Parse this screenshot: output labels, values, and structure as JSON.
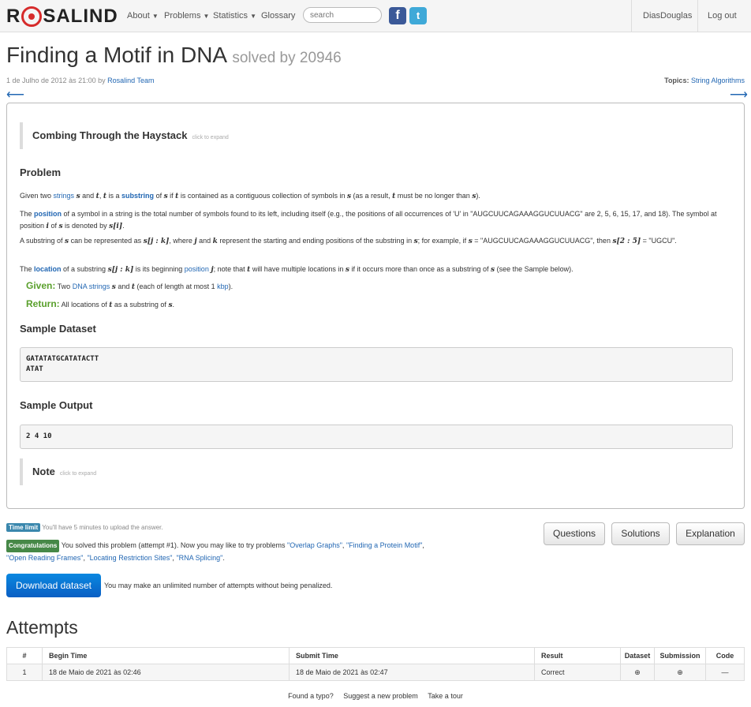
{
  "nav": {
    "brand_left": "R",
    "brand_right": "SALIND",
    "about": "About",
    "problems": "Problems",
    "statistics": "Statistics",
    "glossary": "Glossary",
    "search_placeholder": "search",
    "user": "DiasDouglas",
    "logout": "Log out"
  },
  "page": {
    "title": "Finding a Motif in DNA",
    "solved": "solved by 20946",
    "date": "1 de Julho de 2012 às 21:00 by",
    "author": "Rosalind Team",
    "topics_label": "Topics:",
    "topics": "String Algorithms"
  },
  "panel": {
    "combing_title": "Combing Through the Haystack",
    "combing_hint": "click to expand",
    "problem_heading": "Problem",
    "p1": {
      "a": "Given two ",
      "link1": "strings",
      "b": " and ",
      "c": ", ",
      "d": " is a ",
      "link2": "substring",
      "e": " of ",
      "f": " if ",
      "g": " is contained as a contiguous collection of symbols in ",
      "h": " (as a result, ",
      "i": " must be no longer than ",
      "j": ")."
    },
    "p2": {
      "a": "The ",
      "link": "position",
      "b": " of a symbol in a string is the total number of symbols found to its left, including itself (e.g., the positions of all occurrences of 'U' in \"AUGCUUCAGAAAGGUCUUACG\" are 2, 5, 6, 15, 17, and 18). The symbol at position ",
      "c": " of ",
      "d": " is denoted by ",
      "e": "."
    },
    "p3": {
      "a": "A substring of ",
      "b": " can be represented as ",
      "c": ", where ",
      "d": " and ",
      "e": " represent the starting and ending positions of the substring in ",
      "f": "; for example, if ",
      "g": " = \"AUGCUUCAGAAAGGUCUUACG\", then ",
      "h": " = \"UGCU\"."
    },
    "p4": {
      "a": "The ",
      "link1": "location",
      "b": " of a substring ",
      "c": " is its beginning ",
      "link2": "position",
      "d": " ",
      "e": "; note that ",
      "f": " will have multiple locations in ",
      "g": " if it occurs more than once as a substring of ",
      "h": " (see the Sample below)."
    },
    "given_label": "Given:",
    "given": {
      "a": " Two ",
      "link1": "DNA strings",
      "b": " and ",
      "c": " (each of length at most 1 ",
      "link2": "kbp",
      "d": ")."
    },
    "return_label": "Return:",
    "return": {
      "a": " All locations of ",
      "b": " as a substring of ",
      "c": "."
    },
    "sample_dataset_heading": "Sample Dataset",
    "sample_dataset": "GATATATGCATATACTT\nATAT",
    "sample_output_heading": "Sample Output",
    "sample_output": "2 4 10",
    "note_title": "Note",
    "note_hint": "click to expand"
  },
  "math": {
    "s": "s",
    "t": "t",
    "i": "i",
    "si": "s[i]",
    "sjk": "s[j : k]",
    "j": "j",
    "k": "k",
    "s25": "s[2 : 5]"
  },
  "status": {
    "time_limit_badge": "Time limit",
    "time_limit_text": "You'll have 5 minutes to upload the answer.",
    "congrats_badge": "Congratulations",
    "congrats_text": "You solved this problem (attempt #1). Now you may like to try problems",
    "next1": "\"Overlap Graphs\"",
    "next2": "\"Finding a Protein Motif\"",
    "next3": "\"Open Reading Frames\"",
    "next4": "\"Locating Restriction Sites\"",
    "next5": "\"RNA Splicing\"",
    "comma": ",",
    "period": "."
  },
  "buttons": {
    "questions": "Questions",
    "solutions": "Solutions",
    "explanation": "Explanation",
    "download": "Download dataset",
    "download_note": "You may make an unlimited number of attempts without being penalized."
  },
  "attempts": {
    "heading": "Attempts",
    "columns": [
      "#",
      "Begin Time",
      "Submit Time",
      "Result",
      "Dataset",
      "Submission",
      "Code"
    ],
    "rows": [
      {
        "n": "1",
        "begin": "18 de Maio de 2021 às 02:46",
        "submit": "18 de Maio de 2021 às 02:47",
        "result": "Correct",
        "code": "—"
      }
    ]
  },
  "footer": {
    "typo": "Found a typo?",
    "suggest": "Suggest a new problem",
    "tour": "Take a tour"
  },
  "colors": {
    "link": "#2267b3",
    "given": "#5aa02c",
    "badge_blue": "#3a87ad",
    "badge_green": "#468847",
    "download": "#0a6fd3"
  }
}
